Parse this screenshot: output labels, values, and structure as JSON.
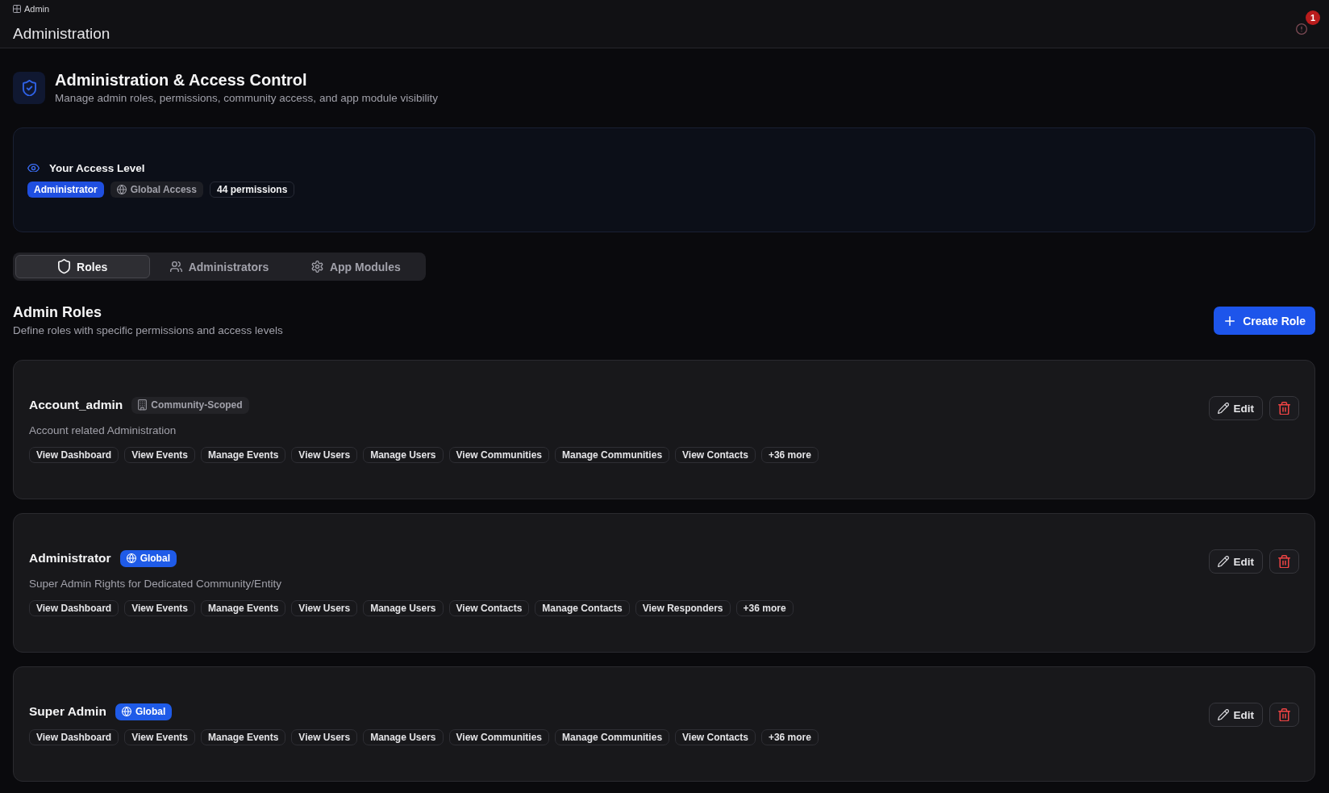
{
  "breadcrumb": {
    "label": "Admin"
  },
  "header": {
    "title": "Administration",
    "notification_count": "1"
  },
  "page_header": {
    "title": "Administration & Access Control",
    "subtitle": "Manage admin roles, permissions, community access, and app module visibility"
  },
  "access_level": {
    "title": "Your Access Level",
    "badges": [
      {
        "kind": "role",
        "label": "Administrator"
      },
      {
        "kind": "scope",
        "label": "Global Access"
      },
      {
        "kind": "count",
        "label": "44 permissions"
      }
    ]
  },
  "tabs": [
    {
      "label": "Roles",
      "selected": true
    },
    {
      "label": "Administrators",
      "selected": false
    },
    {
      "label": "App Modules",
      "selected": false
    }
  ],
  "section": {
    "title": "Admin Roles",
    "subtitle": "Define roles with specific permissions and access levels",
    "create_button": "Create Role"
  },
  "roles": [
    {
      "name": "Account_admin",
      "scope": {
        "kind": "community",
        "label": "Community-Scoped"
      },
      "description": "Account related Administration",
      "permissions": [
        "View Dashboard",
        "View Events",
        "Manage Events",
        "View Users",
        "Manage Users",
        "View Communities",
        "Manage Communities",
        "View Contacts"
      ],
      "more": "+36 more",
      "edit_button": "Edit"
    },
    {
      "name": "Administrator",
      "scope": {
        "kind": "global",
        "label": "Global"
      },
      "description": "Super Admin Rights for Dedicated Community/Entity",
      "permissions": [
        "View Dashboard",
        "View Events",
        "Manage Events",
        "View Users",
        "Manage Users",
        "View Contacts",
        "Manage Contacts",
        "View Responders"
      ],
      "more": "+36 more",
      "edit_button": "Edit"
    },
    {
      "name": "Super Admin",
      "scope": {
        "kind": "global",
        "label": "Global"
      },
      "permissions": [
        "View Dashboard",
        "View Events",
        "Manage Events",
        "View Users",
        "Manage Users",
        "View Communities",
        "Manage Communities",
        "View Contacts"
      ],
      "more": "+36 more",
      "edit_button": "Edit"
    }
  ]
}
